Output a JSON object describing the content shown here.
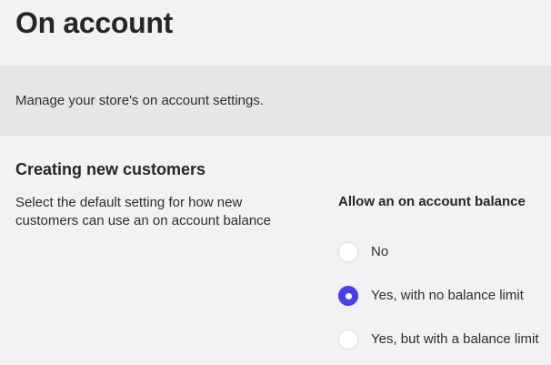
{
  "header": {
    "title": "On account"
  },
  "intro": {
    "description": "Manage your store's on account settings."
  },
  "section": {
    "heading": "Creating new customers",
    "description": "Select the default setting for how new customers can use an on account balance"
  },
  "balance_setting": {
    "legend": "Allow an on account balance",
    "options": [
      {
        "label": "No",
        "selected": false
      },
      {
        "label": "Yes, with no balance limit",
        "selected": true
      },
      {
        "label": "Yes, but with a balance limit",
        "selected": false
      }
    ]
  },
  "colors": {
    "accent": "#4a3ee6",
    "band": "#e6e5e8",
    "background": "#f2f1f3"
  }
}
